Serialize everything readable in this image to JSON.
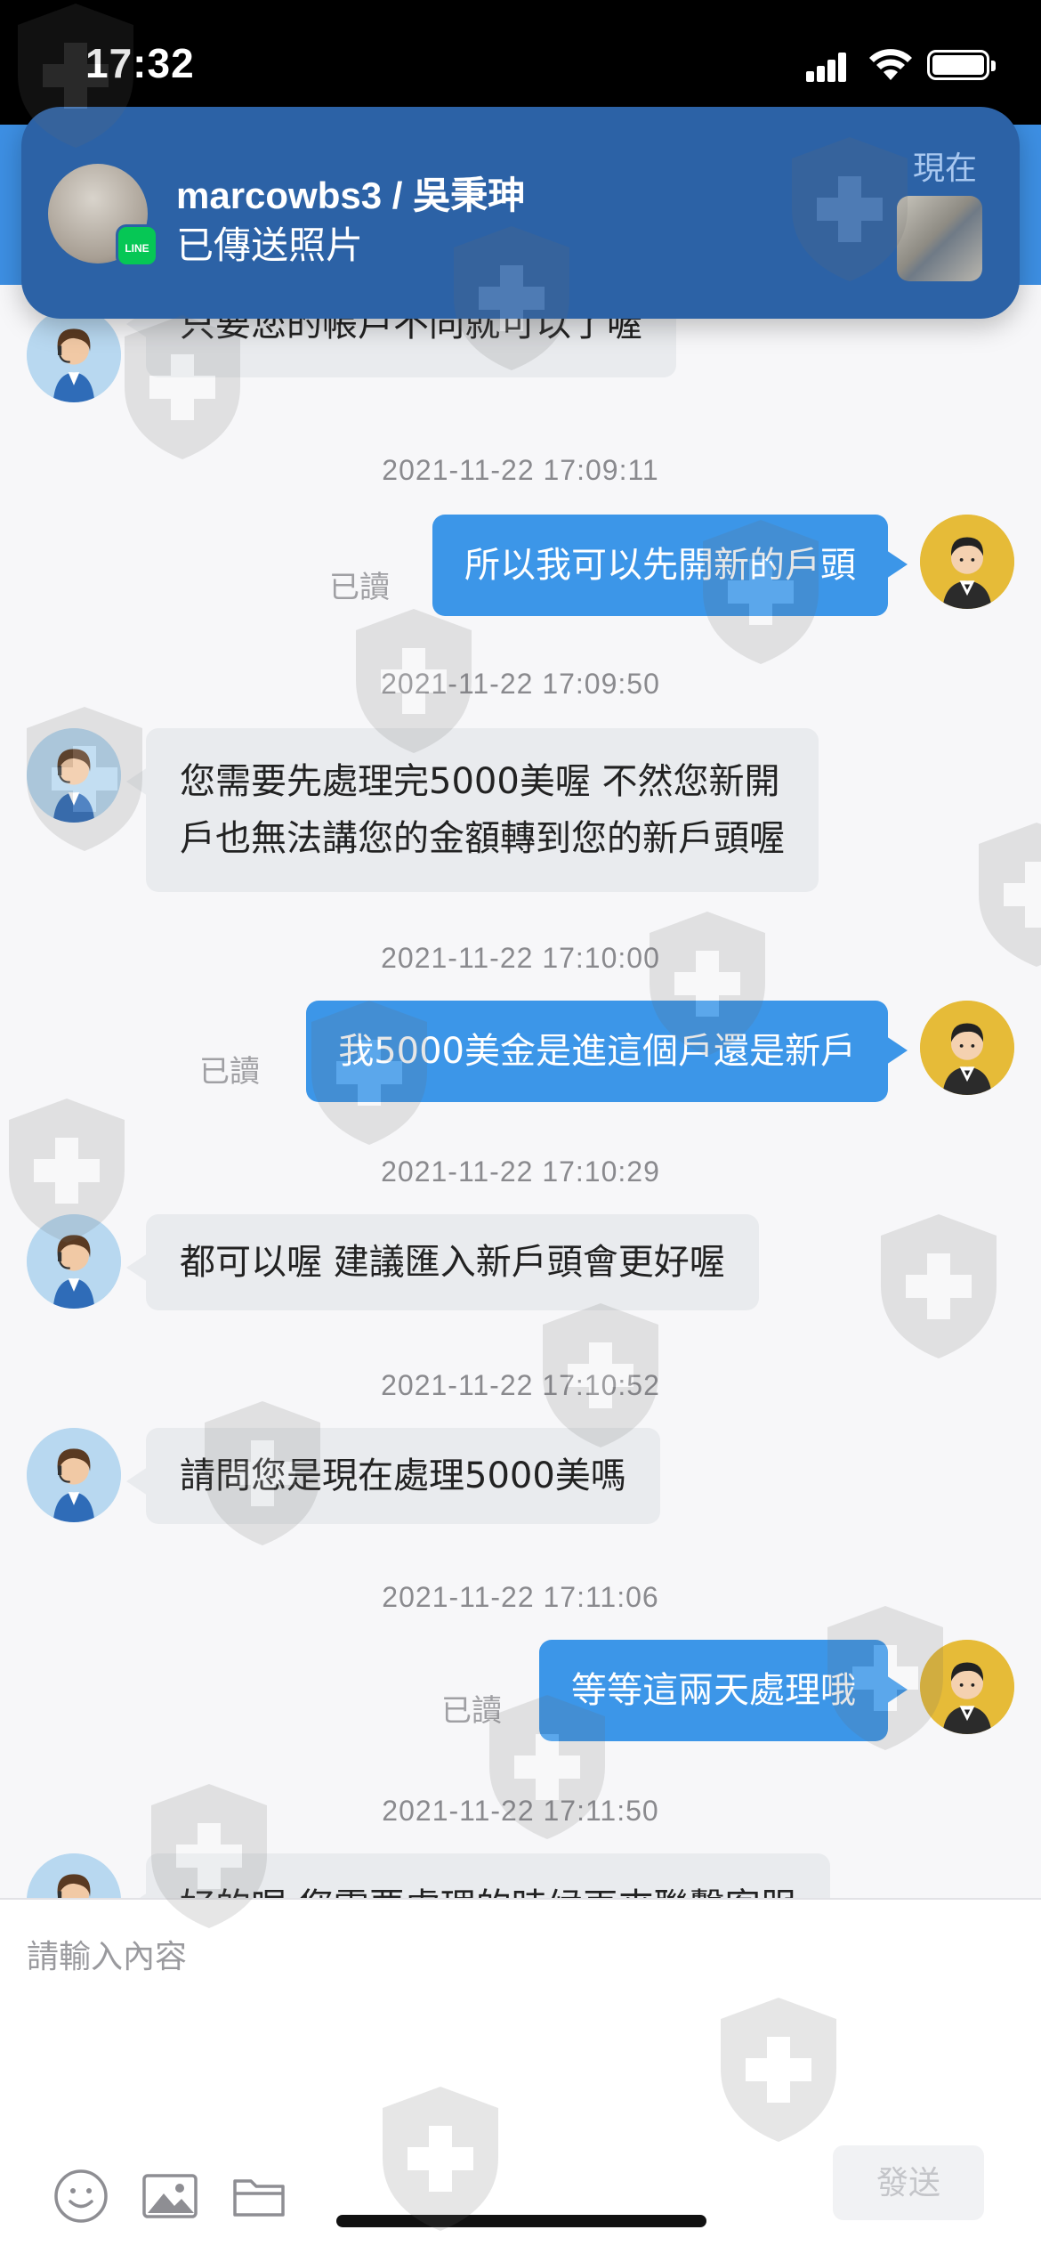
{
  "status_bar": {
    "time": "17:32"
  },
  "notification": {
    "sender": "marcowbs3 / 吳秉珅",
    "message": "已傳送照片",
    "time": "現在",
    "app_badge": "LINE"
  },
  "messages": [
    {
      "side": "in",
      "text": "只要您的帳戶不同就可以了喔"
    },
    {
      "timestamp": "2021-11-22 17:09:11",
      "side": "out",
      "text": "所以我可以先開新的戶頭",
      "read": "已讀"
    },
    {
      "timestamp": "2021-11-22 17:09:50",
      "side": "in",
      "lines": [
        "您需要先處理完5000美喔 不然您新開",
        "戶也無法講您的金額轉到您的新戶頭喔"
      ]
    },
    {
      "timestamp": "2021-11-22 17:10:00",
      "side": "out",
      "text": "我5000美金是進這個戶還是新戶",
      "read": "已讀"
    },
    {
      "timestamp": "2021-11-22 17:10:29",
      "side": "in",
      "text": "都可以喔 建議匯入新戶頭會更好喔"
    },
    {
      "timestamp": "2021-11-22 17:10:52",
      "side": "in",
      "text": "請問您是現在處理5000美嗎"
    },
    {
      "timestamp": "2021-11-22 17:11:06",
      "side": "out",
      "text": "等等這兩天處理哦",
      "read": "已讀"
    },
    {
      "timestamp": "2021-11-22 17:11:50",
      "side": "in",
      "text": "好的喔 您需要處理的時候再來聯繫客服"
    }
  ],
  "input": {
    "placeholder": "請輸入內容",
    "send_label": "發送"
  },
  "colors": {
    "accent": "#3c96e8",
    "notification_bg": "#2c62a6",
    "incoming_bubble": "#e9ebee"
  }
}
